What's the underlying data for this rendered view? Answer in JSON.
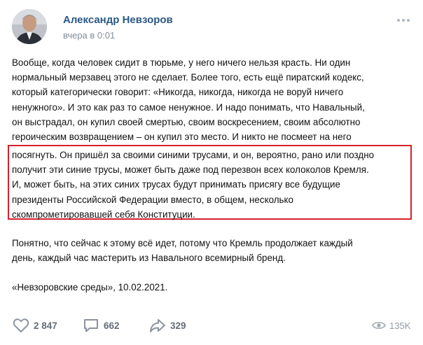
{
  "post": {
    "author_name": "Александр Невзоров",
    "timestamp": "вчера в 0:01",
    "menu_icon": "more-horizontal-icon",
    "paragraph1": [
      "Вообще, когда человек сидит в тюрьме, у него ничего нельзя красть. Ни один",
      "нормальный мерзавец этого не сделает. Более того, есть ещё пиратский кодекс,",
      "который категорически говорит: «Никогда, никогда, никогда не воруй ничего",
      "ненужного». И это как раз то самое ненужное. И надо понимать, что Навальный,",
      "он выстрадал, он купил своей смертью, своим воскресением, своим абсолютно",
      "героическим возвращением – он купил это место. И никто не посмеет на него"
    ],
    "paragraph1_highlighted": [
      "посягнуть. Он пришёл за своими синими трусами, и он, вероятно, рано или поздно",
      "получит эти синие трусы, может быть даже под перезвон всех колоколов Кремля.",
      "И, может быть, на этих синих трусах будут принимать присягу все будущие",
      "президенты Российской Федерации вместо, в общем, несколько",
      "скомпрометировавшей себя Конституции."
    ],
    "paragraph2": [
      "Понятно, что сейчас к этому всё идет, потому что Кремль продолжает каждый",
      "день, каждый час мастерить из Навального всемирный бренд."
    ],
    "paragraph3": "«Невзоровские среды», 10.02.2021.",
    "highlight_color": "#d6202a",
    "link_color": "#2a5885"
  },
  "actions": {
    "likes": {
      "icon": "heart-icon",
      "count": "2 847"
    },
    "comments": {
      "icon": "comment-icon",
      "count": "662"
    },
    "shares": {
      "icon": "share-arrow-icon",
      "count": "329"
    },
    "views": {
      "icon": "eye-icon",
      "count": "135K"
    }
  }
}
